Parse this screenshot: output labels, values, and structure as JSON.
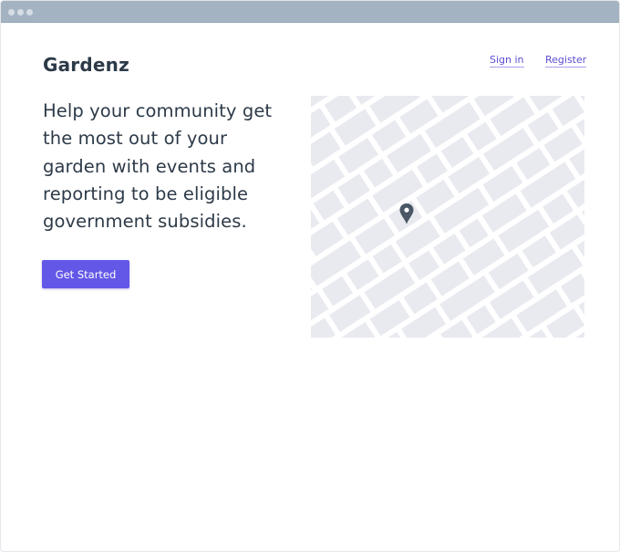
{
  "header": {
    "brand": "Gardenz",
    "nav": {
      "sign_in": "Sign in",
      "register": "Register"
    }
  },
  "hero": {
    "headline_lines": [
      "Help your community get",
      "the most out of your",
      "garden with events and",
      "reporting to be eligible",
      "government subsidies."
    ],
    "cta_label": "Get Started"
  },
  "map": {
    "marker_icon": "location-pin-icon"
  },
  "colors": {
    "accent": "#6357e8",
    "text": "#2d3a48",
    "titlebar": "#a3b3c2",
    "map_block": "#e8eaef",
    "marker": "#4a5766"
  }
}
